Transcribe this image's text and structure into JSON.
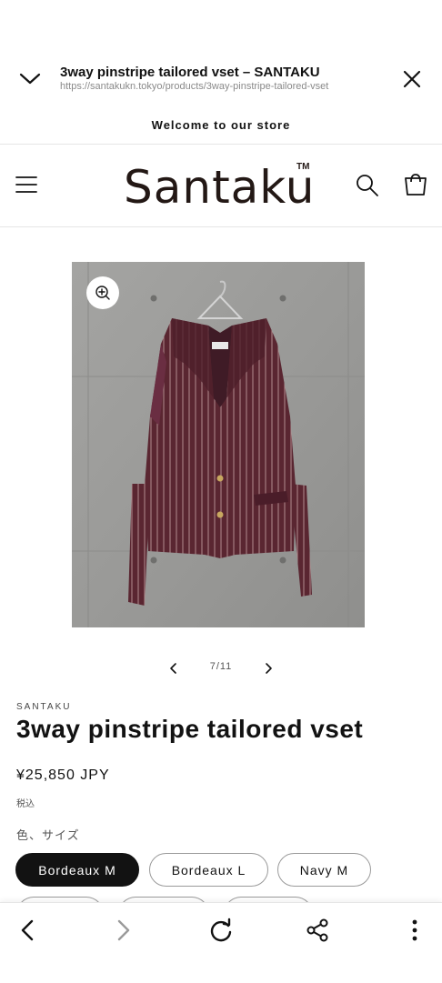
{
  "tab": {
    "title": "3way pinstripe tailored vset – SANTAKU",
    "url": "https://santakukn.tokyo/products/3way-pinstripe-tailored-vset"
  },
  "announcement": "Welcome to our store",
  "store": {
    "logo": "Santaku",
    "logo_tm": "TM"
  },
  "gallery": {
    "counter": "7/11"
  },
  "product": {
    "vendor": "SANTAKU",
    "title": "3way pinstripe tailored vset",
    "price": "¥25,850 JPY",
    "tax_note": "税込",
    "option_label": "色、サイズ",
    "variants": [
      "Bordeaux M",
      "Bordeaux L",
      "Navy M"
    ],
    "selected_variant": "Bordeaux M"
  },
  "icons": {
    "collapse": "chevron-down-icon",
    "close": "close-icon",
    "menu": "hamburger-icon",
    "search": "search-icon",
    "cart": "cart-icon",
    "zoom": "zoom-in-icon",
    "back": "back-arrow-icon",
    "forward": "forward-arrow-icon",
    "reload": "reload-icon",
    "share": "share-icon",
    "more": "more-vertical-icon"
  }
}
